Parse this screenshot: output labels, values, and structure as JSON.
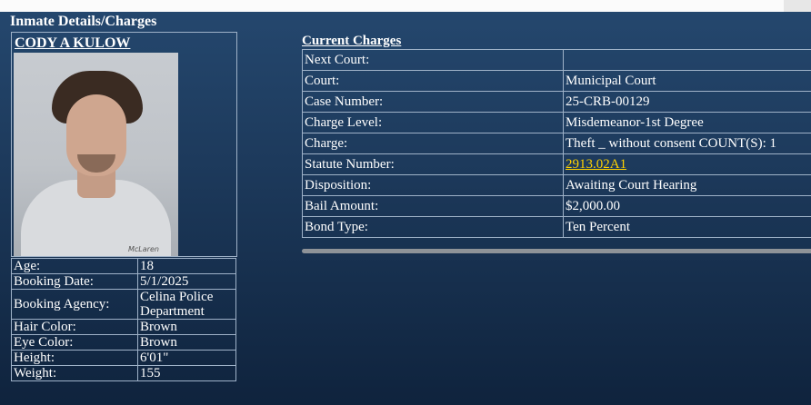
{
  "page": {
    "section_title": "Inmate Details/Charges"
  },
  "inmate": {
    "name": "CODY A KULOW",
    "photo_brand": "McLaren",
    "details": [
      {
        "label": "Age:",
        "value": "18"
      },
      {
        "label": "Booking Date:",
        "value": "5/1/2025"
      },
      {
        "label": "Booking Agency:",
        "value": "Celina Police Department"
      },
      {
        "label": "Hair Color:",
        "value": "Brown"
      },
      {
        "label": "Eye Color:",
        "value": "Brown"
      },
      {
        "label": "Height:",
        "value": "6'01\""
      },
      {
        "label": "Weight:",
        "value": "155"
      }
    ]
  },
  "charges": {
    "title": "Current Charges",
    "rows": [
      {
        "label": "Next Court:",
        "value": ""
      },
      {
        "label": "Court:",
        "value": "Municipal Court"
      },
      {
        "label": "Case Number:",
        "value": "25-CRB-00129"
      },
      {
        "label": "Charge Level:",
        "value": "Misdemeanor-1st Degree"
      },
      {
        "label": "Charge:",
        "value": "Theft _ without consent  COUNT(S): 1"
      },
      {
        "label": "Statute Number:",
        "value": "2913.02A1"
      },
      {
        "label": "Disposition:",
        "value": "Awaiting Court Hearing"
      },
      {
        "label": "Bail Amount:",
        "value": "$2,000.00"
      },
      {
        "label": "Bond Type:",
        "value": "Ten Percent"
      }
    ]
  },
  "colors": {
    "link": "#ffd200",
    "border": "#9fb2c8"
  }
}
